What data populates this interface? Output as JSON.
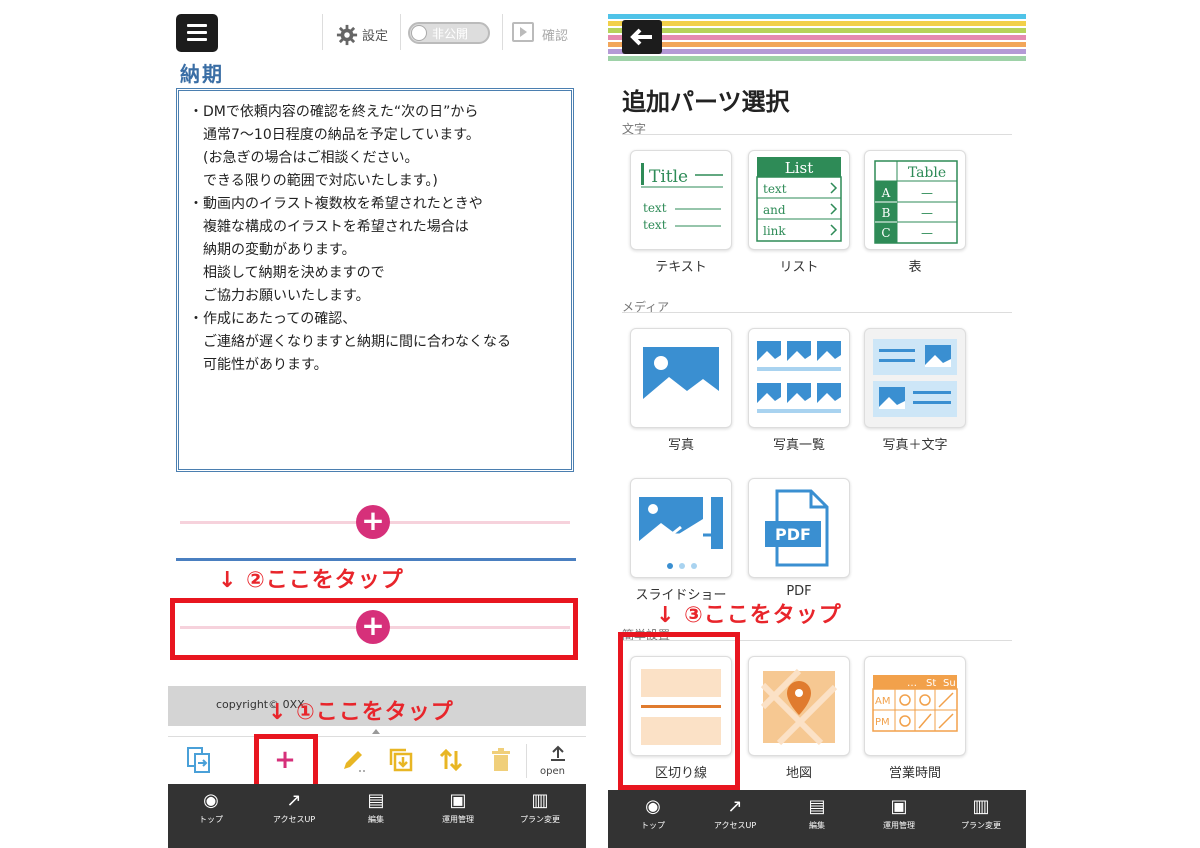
{
  "left_screen": {
    "topbar": {
      "settings_label": "設定",
      "toggle_label": "非公開",
      "confirm_label": "確認"
    },
    "section_title": "納期",
    "content_lines": [
      "・DMで依頼内容の確認を終えた“次の日”から",
      "　通常7〜10日程度の納品を予定しています。",
      "　(お急ぎの場合はご相談ください。",
      "　できる限りの範囲で対応いたします。)",
      "",
      "・動画内のイラスト複数枚を希望されたときや",
      "　複雑な構成のイラストを希望された場合は",
      "　納期の変動があります。",
      "　相談して納期を決めますので",
      "　ご協力お願いいたします。",
      "",
      "・作成にあたっての確認、",
      "　ご連絡が遅くなりますと納期に間に合わなくなる",
      "　可能性があります。"
    ],
    "add_glyph": "+",
    "annotation_2": "↓ ②ここをタップ",
    "annotation_1": "↓ ①ここをタップ",
    "copyright": "copyright© 0XX",
    "toolbar": {
      "open_label": "open",
      "add_glyph": "+"
    },
    "nav": [
      {
        "label": "トップ",
        "icon": "target-icon"
      },
      {
        "label": "アクセスUP",
        "icon": "chart-up-icon"
      },
      {
        "label": "編集",
        "icon": "document-icon"
      },
      {
        "label": "運用管理",
        "icon": "screen-icon"
      },
      {
        "label": "プラン変更",
        "icon": "sparkle-doc-icon"
      }
    ]
  },
  "right_screen": {
    "title": "追加パーツ選択",
    "categories": {
      "text": "文字",
      "media": "メディア",
      "layout": "簡単設置"
    },
    "cards": {
      "text_card": {
        "label": "テキスト",
        "thumb_title": "Title",
        "line1": "text",
        "line2": "text"
      },
      "list_card": {
        "label": "リスト",
        "thumb_title": "List",
        "items": [
          "text",
          "and",
          "link"
        ]
      },
      "table_card": {
        "label": "表",
        "thumb_title": "Table",
        "rows": [
          "A",
          "B",
          "C"
        ],
        "dash": "—"
      },
      "photo": {
        "label": "写真"
      },
      "photo_list": {
        "label": "写真一覧"
      },
      "photo_text": {
        "label": "写真＋文字"
      },
      "slideshow": {
        "label": "スライドショー"
      },
      "pdf": {
        "label": "PDF",
        "thumb_text": "PDF"
      },
      "divider": {
        "label": "区切り線"
      },
      "map": {
        "label": "地図"
      },
      "hours": {
        "label": "営業時間",
        "dots": "…",
        "sat": "St",
        "sun": "Su",
        "am": "AM",
        "pm": "PM"
      }
    },
    "annotation_3": "↓ ③ここをタップ",
    "nav": [
      {
        "label": "トップ",
        "icon": "target-icon"
      },
      {
        "label": "アクセスUP",
        "icon": "chart-up-icon"
      },
      {
        "label": "編集",
        "icon": "document-icon"
      },
      {
        "label": "運用管理",
        "icon": "screen-icon"
      },
      {
        "label": "プラン変更",
        "icon": "sparkle-doc-icon"
      }
    ],
    "stripe_colors": [
      "#4fc3e8",
      "#f2d04a",
      "#b6d35a",
      "#e58ab0",
      "#f2a65a",
      "#b49ad6",
      "#9ed2a8"
    ]
  },
  "colors": {
    "accent_pink": "#d6307a",
    "annotation_red": "#e8252b",
    "section_blue": "#3a6ea5",
    "nav_bg": "#333333"
  }
}
